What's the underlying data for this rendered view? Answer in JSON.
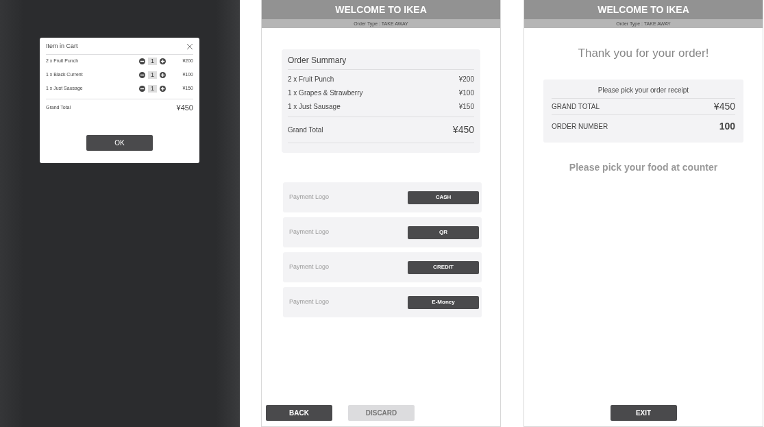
{
  "cart_screen": {
    "modal": {
      "title": "Item in Cart",
      "items": [
        {
          "name": "2 x Fruit Punch",
          "quantity": "1",
          "price": "¥200"
        },
        {
          "name": "1 x Black Current",
          "quantity": "1",
          "price": "¥100"
        },
        {
          "name": "1 x Just Sausage",
          "quantity": "1",
          "price": "¥150"
        }
      ],
      "total_label": "Grand Total",
      "total": "¥450",
      "ok_button": "OK"
    }
  },
  "payment_screen": {
    "header": {
      "title": "WELCOME TO IKEA",
      "order_type": "Order Type : TAKE AWAY"
    },
    "summary": {
      "title": "Order Summary",
      "items": [
        {
          "name": "2 x Fruit Punch",
          "price": "¥200"
        },
        {
          "name": "1 x Grapes & Strawberry",
          "price": "¥100"
        },
        {
          "name": "1 x Just Sausage",
          "price": "¥150"
        }
      ],
      "total_label": "Grand Total",
      "total": "¥450"
    },
    "payment_methods": [
      {
        "logo": "Payment Logo",
        "button": "CASH"
      },
      {
        "logo": "Payment Logo",
        "button": "QR"
      },
      {
        "logo": "Payment Logo",
        "button": "CREDIT"
      },
      {
        "logo": "Payment Logo",
        "button": "E-Money"
      }
    ],
    "buttons": [
      {
        "label": "BACK",
        "disabled": false
      },
      {
        "label": "DISCARD",
        "disabled": true
      }
    ]
  },
  "confirmation_screen": {
    "header": {
      "title": "WELCOME TO IKEA",
      "order_type": "Order Type : TAKE AWAY"
    },
    "heading": "Thank you for your order!",
    "receipt": {
      "note": "Please pick your order receipt",
      "rows": [
        {
          "label": "GRAND TOTAL",
          "value": "¥450"
        },
        {
          "label": "ORDER NUMBER",
          "value": "100"
        }
      ]
    },
    "pickup_note": "Please pick your food at counter",
    "exit_button": "EXIT"
  }
}
